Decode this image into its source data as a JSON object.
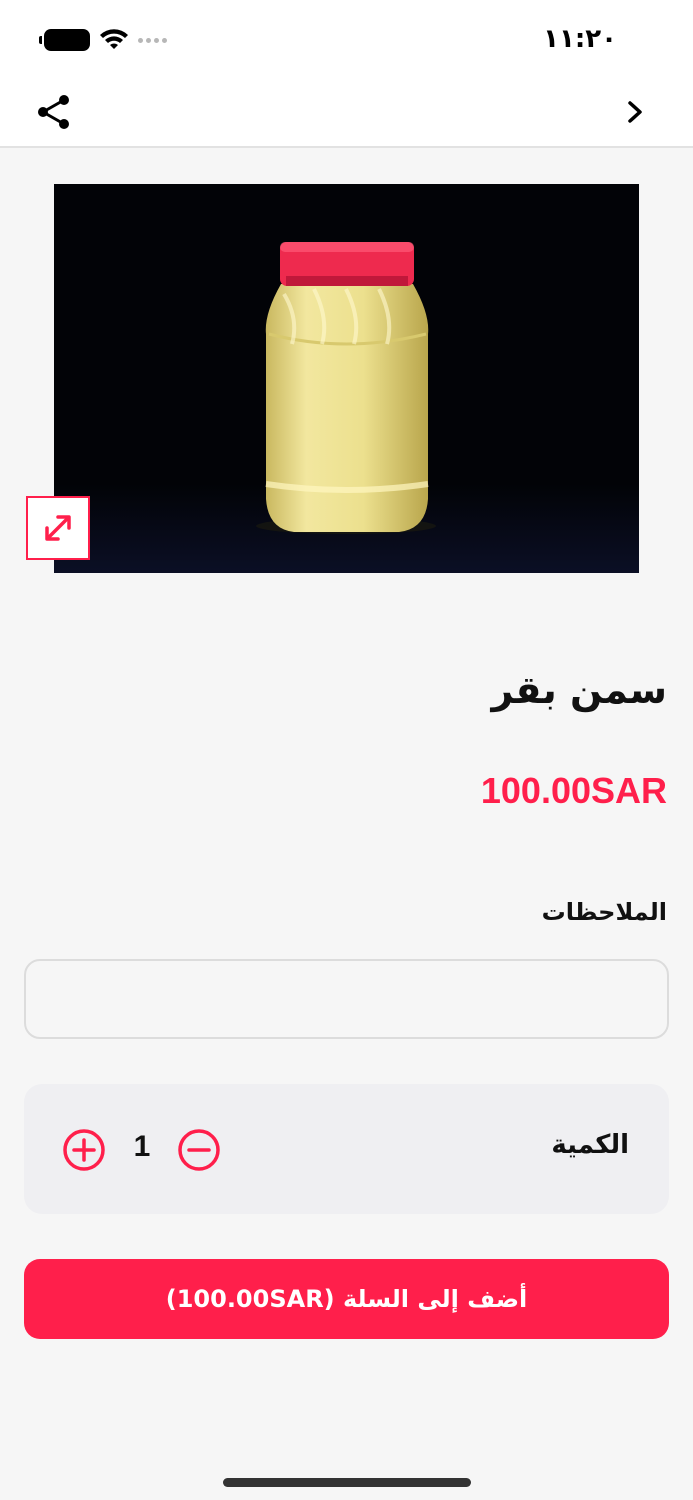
{
  "status_bar": {
    "time": "١١:٢٠",
    "icons": [
      "battery-icon",
      "wifi-icon",
      "signal-icon"
    ]
  },
  "nav": {
    "icons": [
      "share-icon",
      "chevron-right-icon"
    ]
  },
  "product": {
    "image_description": "jar-of-ghee",
    "title": "سمن بقر",
    "price": "100.00SAR"
  },
  "notes": {
    "label": "الملاحظات",
    "value": "",
    "placeholder": ""
  },
  "quantity": {
    "label": "الكمية",
    "value": "1"
  },
  "cart_button": {
    "label": "أضف إلى السلة (100.00SAR)"
  },
  "colors": {
    "accent": "#ff1f4b",
    "background": "#f6f6f6",
    "qty_box": "#efeff2"
  }
}
